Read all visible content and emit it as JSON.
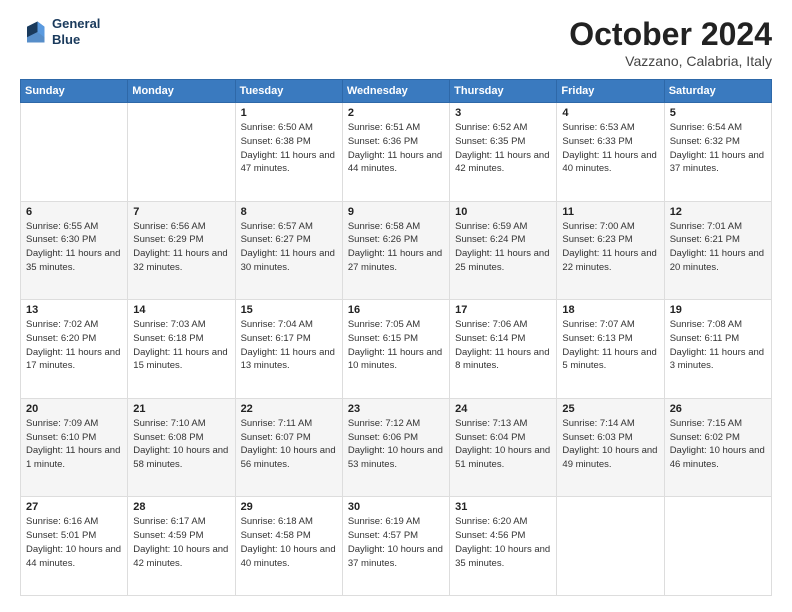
{
  "header": {
    "logo_line1": "General",
    "logo_line2": "Blue",
    "month": "October 2024",
    "location": "Vazzano, Calabria, Italy"
  },
  "weekdays": [
    "Sunday",
    "Monday",
    "Tuesday",
    "Wednesday",
    "Thursday",
    "Friday",
    "Saturday"
  ],
  "weeks": [
    [
      {
        "day": "",
        "info": ""
      },
      {
        "day": "",
        "info": ""
      },
      {
        "day": "1",
        "info": "Sunrise: 6:50 AM\nSunset: 6:38 PM\nDaylight: 11 hours and 47 minutes."
      },
      {
        "day": "2",
        "info": "Sunrise: 6:51 AM\nSunset: 6:36 PM\nDaylight: 11 hours and 44 minutes."
      },
      {
        "day": "3",
        "info": "Sunrise: 6:52 AM\nSunset: 6:35 PM\nDaylight: 11 hours and 42 minutes."
      },
      {
        "day": "4",
        "info": "Sunrise: 6:53 AM\nSunset: 6:33 PM\nDaylight: 11 hours and 40 minutes."
      },
      {
        "day": "5",
        "info": "Sunrise: 6:54 AM\nSunset: 6:32 PM\nDaylight: 11 hours and 37 minutes."
      }
    ],
    [
      {
        "day": "6",
        "info": "Sunrise: 6:55 AM\nSunset: 6:30 PM\nDaylight: 11 hours and 35 minutes."
      },
      {
        "day": "7",
        "info": "Sunrise: 6:56 AM\nSunset: 6:29 PM\nDaylight: 11 hours and 32 minutes."
      },
      {
        "day": "8",
        "info": "Sunrise: 6:57 AM\nSunset: 6:27 PM\nDaylight: 11 hours and 30 minutes."
      },
      {
        "day": "9",
        "info": "Sunrise: 6:58 AM\nSunset: 6:26 PM\nDaylight: 11 hours and 27 minutes."
      },
      {
        "day": "10",
        "info": "Sunrise: 6:59 AM\nSunset: 6:24 PM\nDaylight: 11 hours and 25 minutes."
      },
      {
        "day": "11",
        "info": "Sunrise: 7:00 AM\nSunset: 6:23 PM\nDaylight: 11 hours and 22 minutes."
      },
      {
        "day": "12",
        "info": "Sunrise: 7:01 AM\nSunset: 6:21 PM\nDaylight: 11 hours and 20 minutes."
      }
    ],
    [
      {
        "day": "13",
        "info": "Sunrise: 7:02 AM\nSunset: 6:20 PM\nDaylight: 11 hours and 17 minutes."
      },
      {
        "day": "14",
        "info": "Sunrise: 7:03 AM\nSunset: 6:18 PM\nDaylight: 11 hours and 15 minutes."
      },
      {
        "day": "15",
        "info": "Sunrise: 7:04 AM\nSunset: 6:17 PM\nDaylight: 11 hours and 13 minutes."
      },
      {
        "day": "16",
        "info": "Sunrise: 7:05 AM\nSunset: 6:15 PM\nDaylight: 11 hours and 10 minutes."
      },
      {
        "day": "17",
        "info": "Sunrise: 7:06 AM\nSunset: 6:14 PM\nDaylight: 11 hours and 8 minutes."
      },
      {
        "day": "18",
        "info": "Sunrise: 7:07 AM\nSunset: 6:13 PM\nDaylight: 11 hours and 5 minutes."
      },
      {
        "day": "19",
        "info": "Sunrise: 7:08 AM\nSunset: 6:11 PM\nDaylight: 11 hours and 3 minutes."
      }
    ],
    [
      {
        "day": "20",
        "info": "Sunrise: 7:09 AM\nSunset: 6:10 PM\nDaylight: 11 hours and 1 minute."
      },
      {
        "day": "21",
        "info": "Sunrise: 7:10 AM\nSunset: 6:08 PM\nDaylight: 10 hours and 58 minutes."
      },
      {
        "day": "22",
        "info": "Sunrise: 7:11 AM\nSunset: 6:07 PM\nDaylight: 10 hours and 56 minutes."
      },
      {
        "day": "23",
        "info": "Sunrise: 7:12 AM\nSunset: 6:06 PM\nDaylight: 10 hours and 53 minutes."
      },
      {
        "day": "24",
        "info": "Sunrise: 7:13 AM\nSunset: 6:04 PM\nDaylight: 10 hours and 51 minutes."
      },
      {
        "day": "25",
        "info": "Sunrise: 7:14 AM\nSunset: 6:03 PM\nDaylight: 10 hours and 49 minutes."
      },
      {
        "day": "26",
        "info": "Sunrise: 7:15 AM\nSunset: 6:02 PM\nDaylight: 10 hours and 46 minutes."
      }
    ],
    [
      {
        "day": "27",
        "info": "Sunrise: 6:16 AM\nSunset: 5:01 PM\nDaylight: 10 hours and 44 minutes."
      },
      {
        "day": "28",
        "info": "Sunrise: 6:17 AM\nSunset: 4:59 PM\nDaylight: 10 hours and 42 minutes."
      },
      {
        "day": "29",
        "info": "Sunrise: 6:18 AM\nSunset: 4:58 PM\nDaylight: 10 hours and 40 minutes."
      },
      {
        "day": "30",
        "info": "Sunrise: 6:19 AM\nSunset: 4:57 PM\nDaylight: 10 hours and 37 minutes."
      },
      {
        "day": "31",
        "info": "Sunrise: 6:20 AM\nSunset: 4:56 PM\nDaylight: 10 hours and 35 minutes."
      },
      {
        "day": "",
        "info": ""
      },
      {
        "day": "",
        "info": ""
      }
    ]
  ]
}
